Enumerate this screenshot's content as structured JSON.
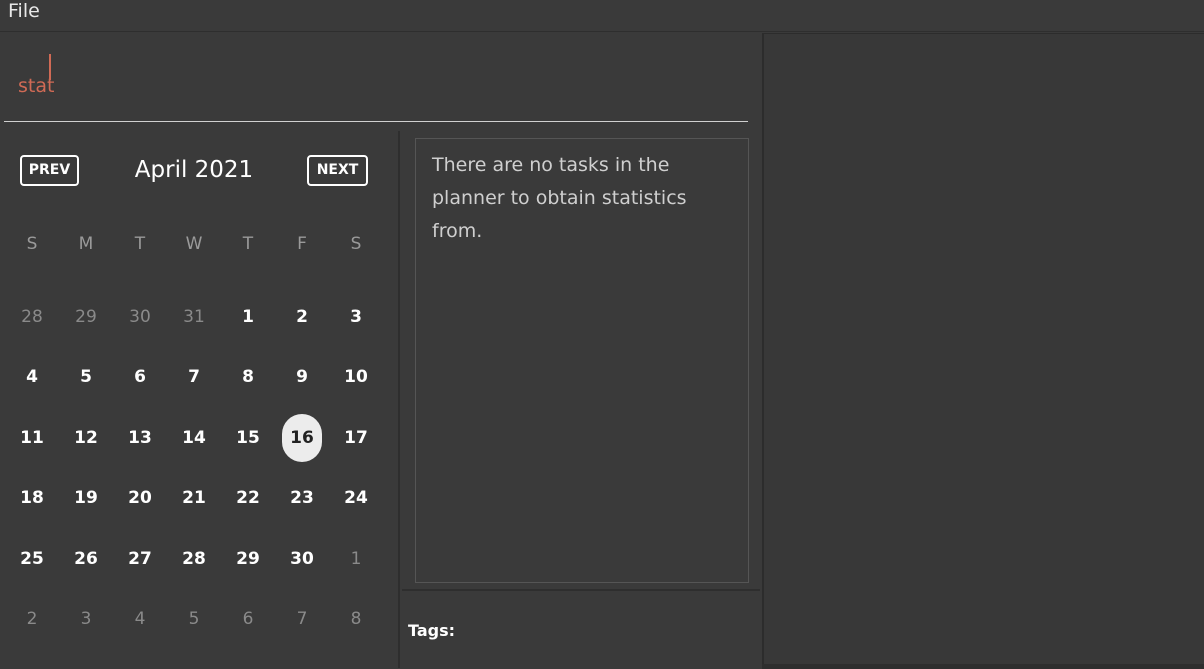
{
  "menu": {
    "file_label": "File"
  },
  "command": {
    "value": "stat"
  },
  "calendar": {
    "prev_label": "PREV",
    "next_label": "NEXT",
    "month_label": "April 2021",
    "weekdays": [
      "S",
      "M",
      "T",
      "W",
      "T",
      "F",
      "S"
    ],
    "weeks": [
      [
        {
          "d": "28",
          "muted": true
        },
        {
          "d": "29",
          "muted": true
        },
        {
          "d": "30",
          "muted": true
        },
        {
          "d": "31",
          "muted": true
        },
        {
          "d": "1"
        },
        {
          "d": "2"
        },
        {
          "d": "3"
        }
      ],
      [
        {
          "d": "4"
        },
        {
          "d": "5"
        },
        {
          "d": "6"
        },
        {
          "d": "7"
        },
        {
          "d": "8"
        },
        {
          "d": "9"
        },
        {
          "d": "10"
        }
      ],
      [
        {
          "d": "11"
        },
        {
          "d": "12"
        },
        {
          "d": "13"
        },
        {
          "d": "14"
        },
        {
          "d": "15"
        },
        {
          "d": "16",
          "today": true
        },
        {
          "d": "17"
        }
      ],
      [
        {
          "d": "18"
        },
        {
          "d": "19"
        },
        {
          "d": "20"
        },
        {
          "d": "21"
        },
        {
          "d": "22"
        },
        {
          "d": "23"
        },
        {
          "d": "24"
        }
      ],
      [
        {
          "d": "25"
        },
        {
          "d": "26"
        },
        {
          "d": "27"
        },
        {
          "d": "28"
        },
        {
          "d": "29"
        },
        {
          "d": "30"
        },
        {
          "d": "1",
          "muted": true
        }
      ],
      [
        {
          "d": "2",
          "muted": true
        },
        {
          "d": "3",
          "muted": true
        },
        {
          "d": "4",
          "muted": true
        },
        {
          "d": "5",
          "muted": true
        },
        {
          "d": "6",
          "muted": true
        },
        {
          "d": "7",
          "muted": true
        },
        {
          "d": "8",
          "muted": true
        }
      ]
    ]
  },
  "stats": {
    "message": "There are no tasks in the planner to obtain statistics from."
  },
  "tags": {
    "label": "Tags:"
  },
  "colors": {
    "background": "#3a3a3a",
    "command_text": "#d06a55",
    "today_highlight": "#ececec"
  }
}
